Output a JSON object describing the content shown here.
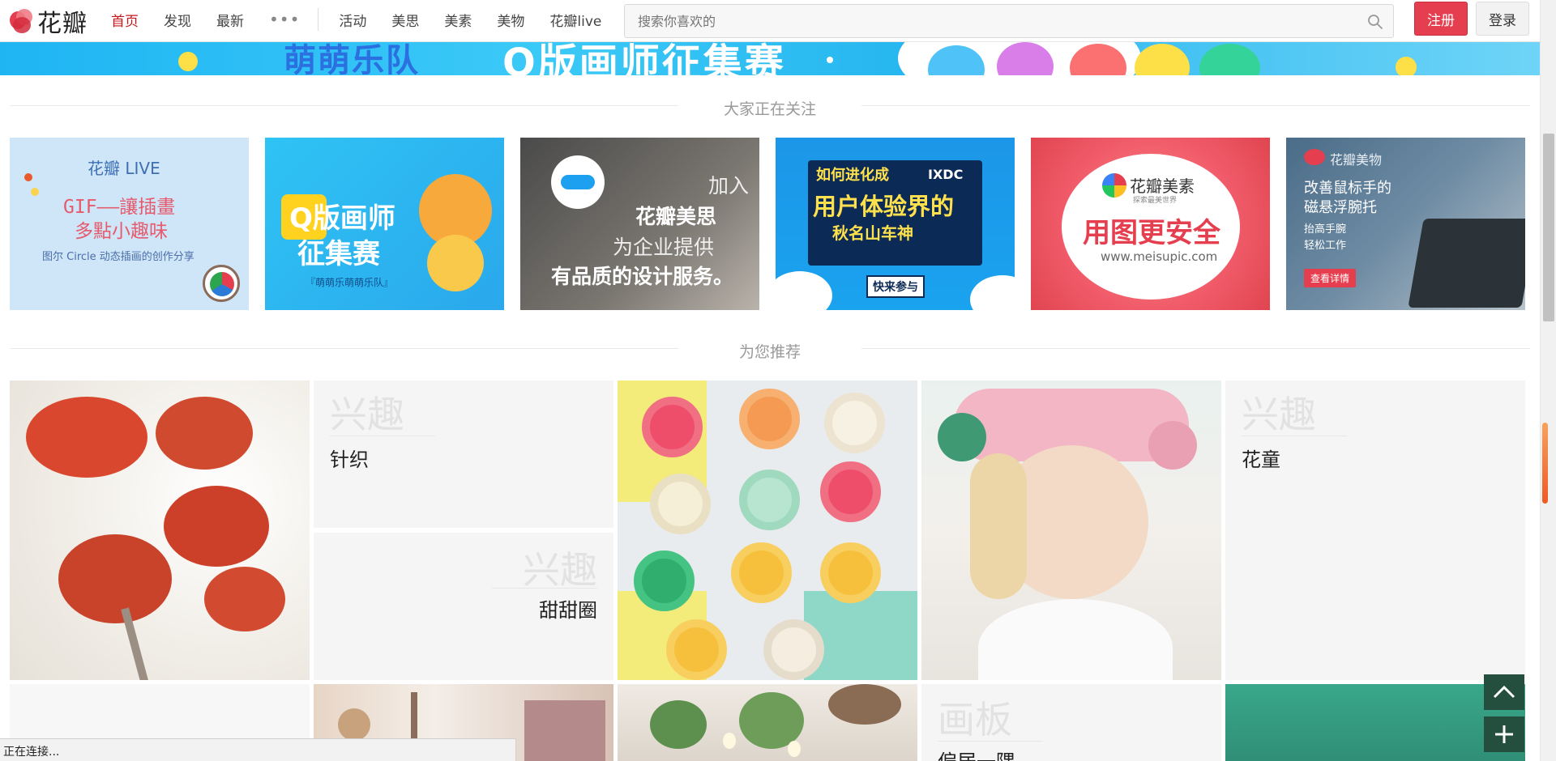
{
  "brand": {
    "logo_text": "花瓣"
  },
  "nav": {
    "links": [
      {
        "label": "首页",
        "active": true
      },
      {
        "label": "发现",
        "active": false
      },
      {
        "label": "最新",
        "active": false
      }
    ],
    "more": "•••",
    "extra_links": [
      "活动",
      "美思",
      "美素",
      "美物",
      "花瓣live"
    ]
  },
  "search": {
    "placeholder": "搜索你喜欢的",
    "value": ""
  },
  "auth": {
    "register_label": "注册",
    "login_label": "登录"
  },
  "banner": {
    "text_left": "萌萌乐队",
    "text_right": "Q版画师征集赛"
  },
  "sections": {
    "featured_title": "大家正在关注",
    "recommend_title": "为您推荐"
  },
  "featured_boards": [
    {
      "lines": [
        "花瓣 LIVE",
        "GIF——讓插畫",
        "多點小趣味",
        "图尔 Circle 动态插画的创作分享"
      ]
    },
    {
      "lines": [
        "Q版画师",
        "征集赛",
        "『萌萌乐萌萌乐队』"
      ]
    },
    {
      "lines": [
        "加入",
        "花瓣美思",
        "为企业提供",
        "有品质的设计服务。"
      ]
    },
    {
      "lines": [
        "如何进化成",
        "IXDC",
        "用户体验界的",
        "秋名山车神",
        "快来参与"
      ]
    },
    {
      "lines": [
        "花瓣美素",
        "探索最美世界",
        "用图更安全",
        "www.meisupic.com"
      ]
    },
    {
      "lines": [
        "花瓣美物",
        "改善鼠标手的",
        "磁悬浮腕托",
        "抬高手腕",
        "轻松工作",
        "查看详情"
      ]
    }
  ],
  "recommend": {
    "tags": [
      {
        "kicker": "兴趣",
        "name": "针织"
      },
      {
        "kicker": "兴趣",
        "name": "甜甜圈"
      },
      {
        "kicker": "兴趣",
        "name": "花童"
      },
      {
        "kicker": "画板",
        "name": "偏居一隅"
      }
    ]
  },
  "float_buttons": {
    "top": "↑",
    "add": "+"
  },
  "statusbar": {
    "text": "正在连接..."
  },
  "colors": {
    "accent": "#c8161d",
    "register_bg": "#e53f4f",
    "float_btn_bg": "#244f3f"
  }
}
